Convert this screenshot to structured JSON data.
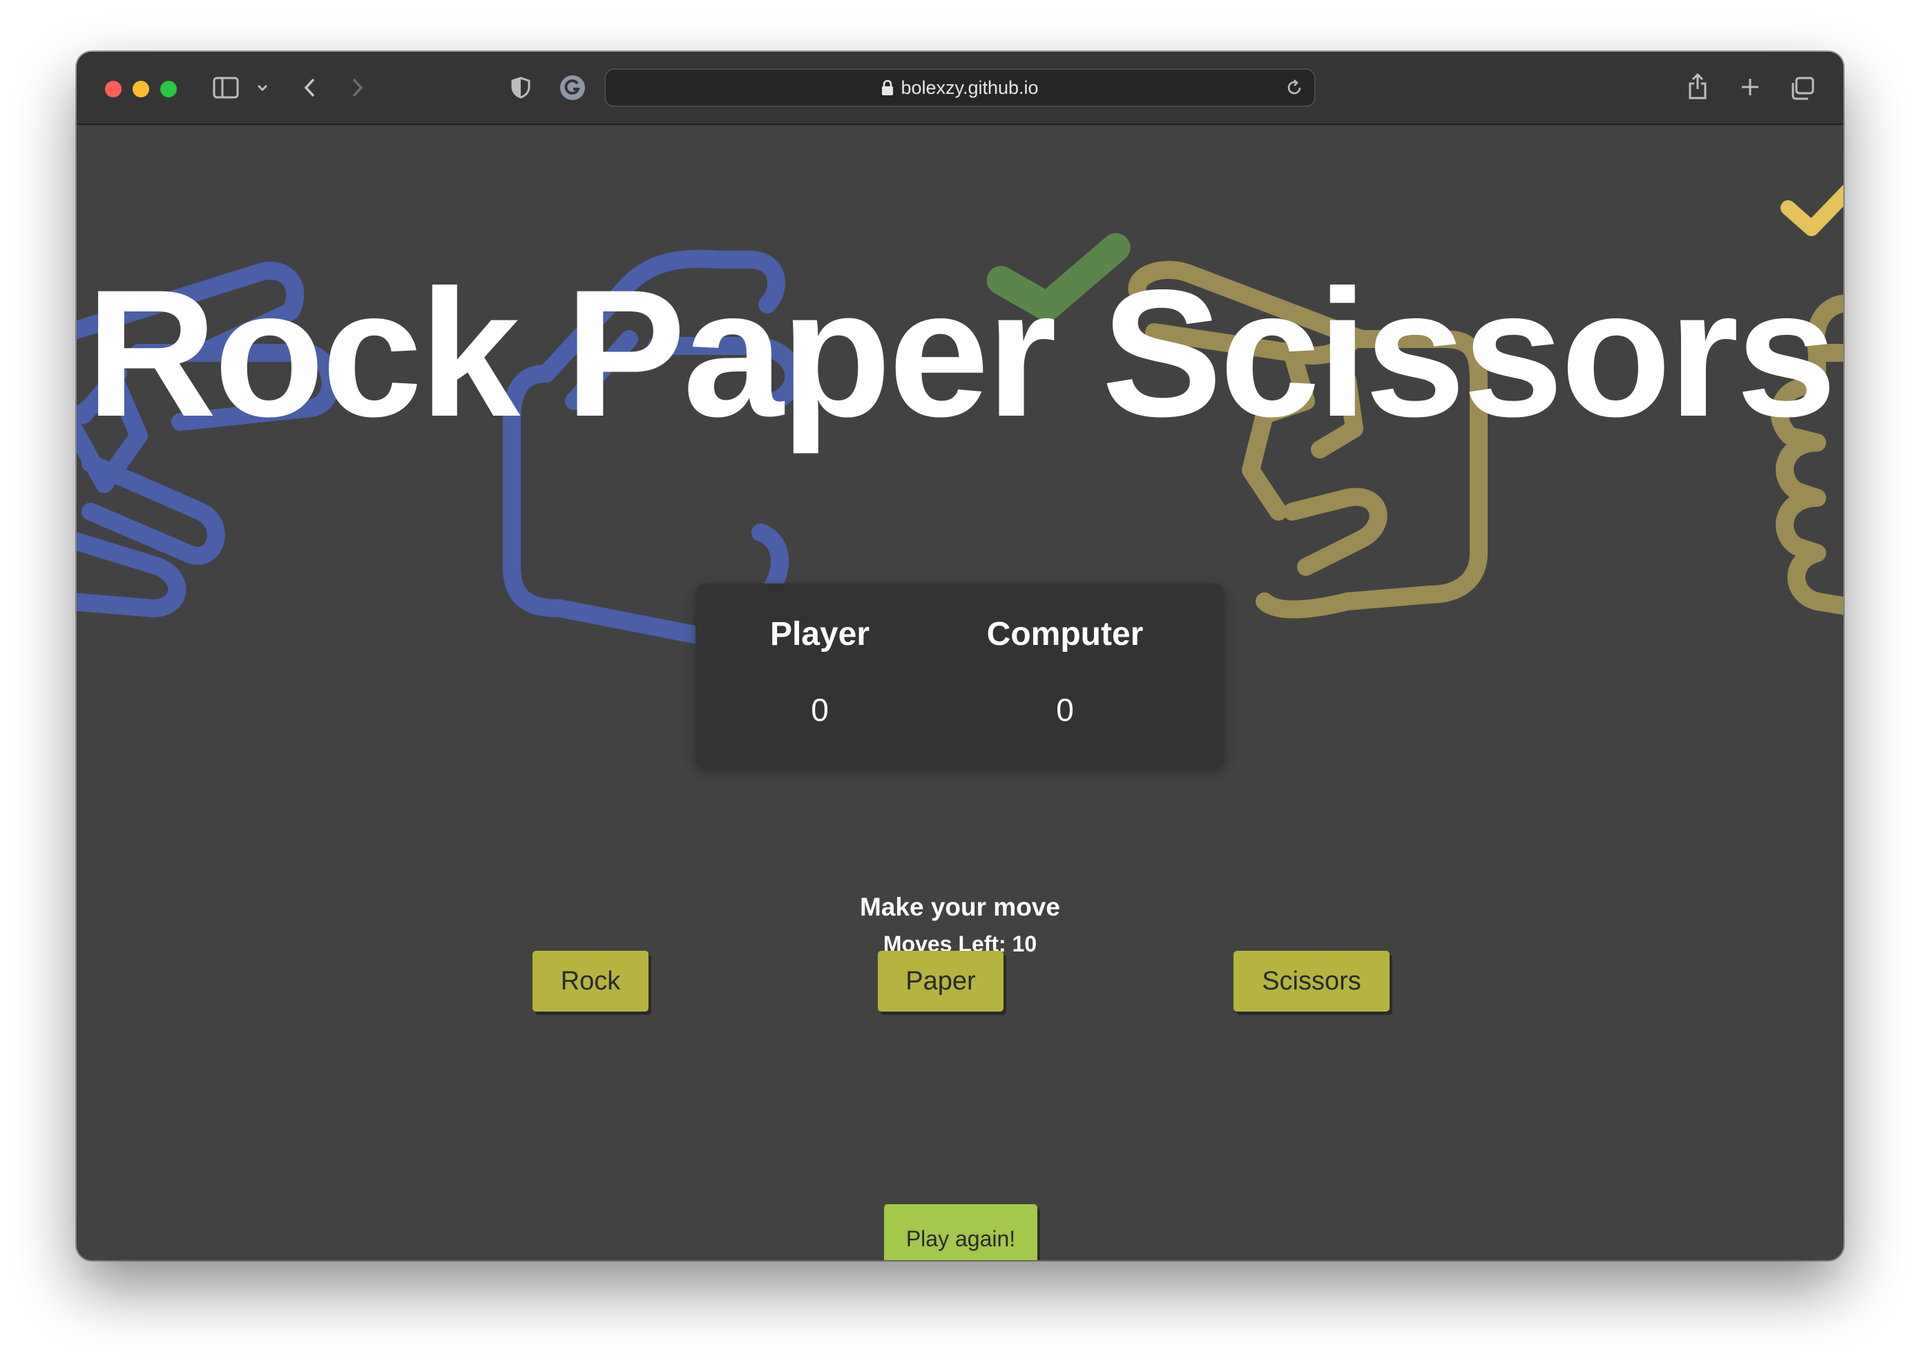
{
  "browser": {
    "url": "bolexzy.github.io",
    "icons": {
      "sidebar": "sidebar-icon",
      "back": "chevron-left-icon",
      "forward": "chevron-right-icon",
      "privacy": "shield-icon",
      "extension": "grammarly-icon",
      "reload": "reload-icon",
      "share": "share-icon",
      "new_tab": "plus-icon",
      "tabs": "tab-overview-icon"
    }
  },
  "game": {
    "title": "Rock Paper Scissors",
    "score": {
      "player_label": "Player",
      "computer_label": "Computer",
      "player_score": "0",
      "computer_score": "0"
    },
    "prompt": "Make your move",
    "moves_left": "Moves Left: 10",
    "buttons": {
      "rock": "Rock",
      "paper": "Paper",
      "scissors": "Scissors",
      "play_again": "Play again!"
    }
  },
  "colors": {
    "page_background": "#424242",
    "score_card": "#333333",
    "move_button": "#b6b43f",
    "play_again_button": "#a4c84a",
    "hand_blue": "#4a5fa8",
    "hand_gold": "#9a8c52",
    "check_green": "#5d8a4a",
    "check_yellow": "#e3c35a"
  }
}
